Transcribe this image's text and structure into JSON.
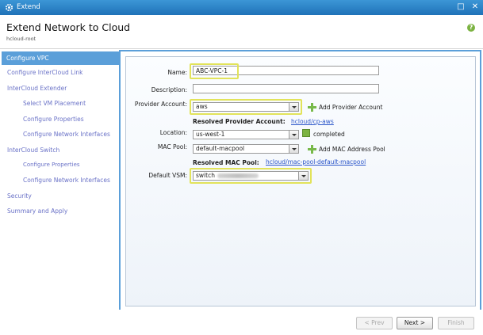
{
  "window": {
    "title": "Extend",
    "minimize_glyph": "□",
    "close_glyph": "✕",
    "icon": "gear-icon"
  },
  "header": {
    "title": "Extend Network to Cloud",
    "breadcrumb": "hcloud-root",
    "help_glyph": "?"
  },
  "sidebar": {
    "items": [
      {
        "label": "Configure VPC",
        "active": true
      },
      {
        "label": "Configure InterCloud Link"
      },
      {
        "label": "InterCloud Extender"
      },
      {
        "label": "Select VM Placement"
      },
      {
        "label": "Configure Properties"
      },
      {
        "label": "Configure Network Interfaces"
      },
      {
        "label": "InterCloud Switch"
      },
      {
        "label": "Configure Properties"
      },
      {
        "label": "Configure Network Interfaces"
      },
      {
        "label": "Security"
      },
      {
        "label": "Summary and Apply"
      }
    ]
  },
  "form": {
    "name": {
      "label": "Name:",
      "value": "ABC-VPC-1"
    },
    "description": {
      "label": "Description:",
      "value": ""
    },
    "provider_account": {
      "label": "Provider Account:",
      "value": "aws",
      "add_label": "Add Provider Account"
    },
    "resolved_provider": {
      "label": "Resolved Provider Account:",
      "link": "hcloud/cp-aws"
    },
    "location": {
      "label": "Location:",
      "value": "us-west-1",
      "status": "completed"
    },
    "mac_pool": {
      "label": "MAC Pool:",
      "value": "default-macpool",
      "add_label": "Add MAC Address Pool"
    },
    "resolved_mac": {
      "label": "Resolved MAC Pool:",
      "link": "hcloud/mac-pool-default-macpool"
    },
    "default_vsm": {
      "label": "Default VSM:",
      "value": "switch"
    }
  },
  "footer": {
    "prev": "< Prev",
    "next": "Next >",
    "finish": "Finish"
  }
}
